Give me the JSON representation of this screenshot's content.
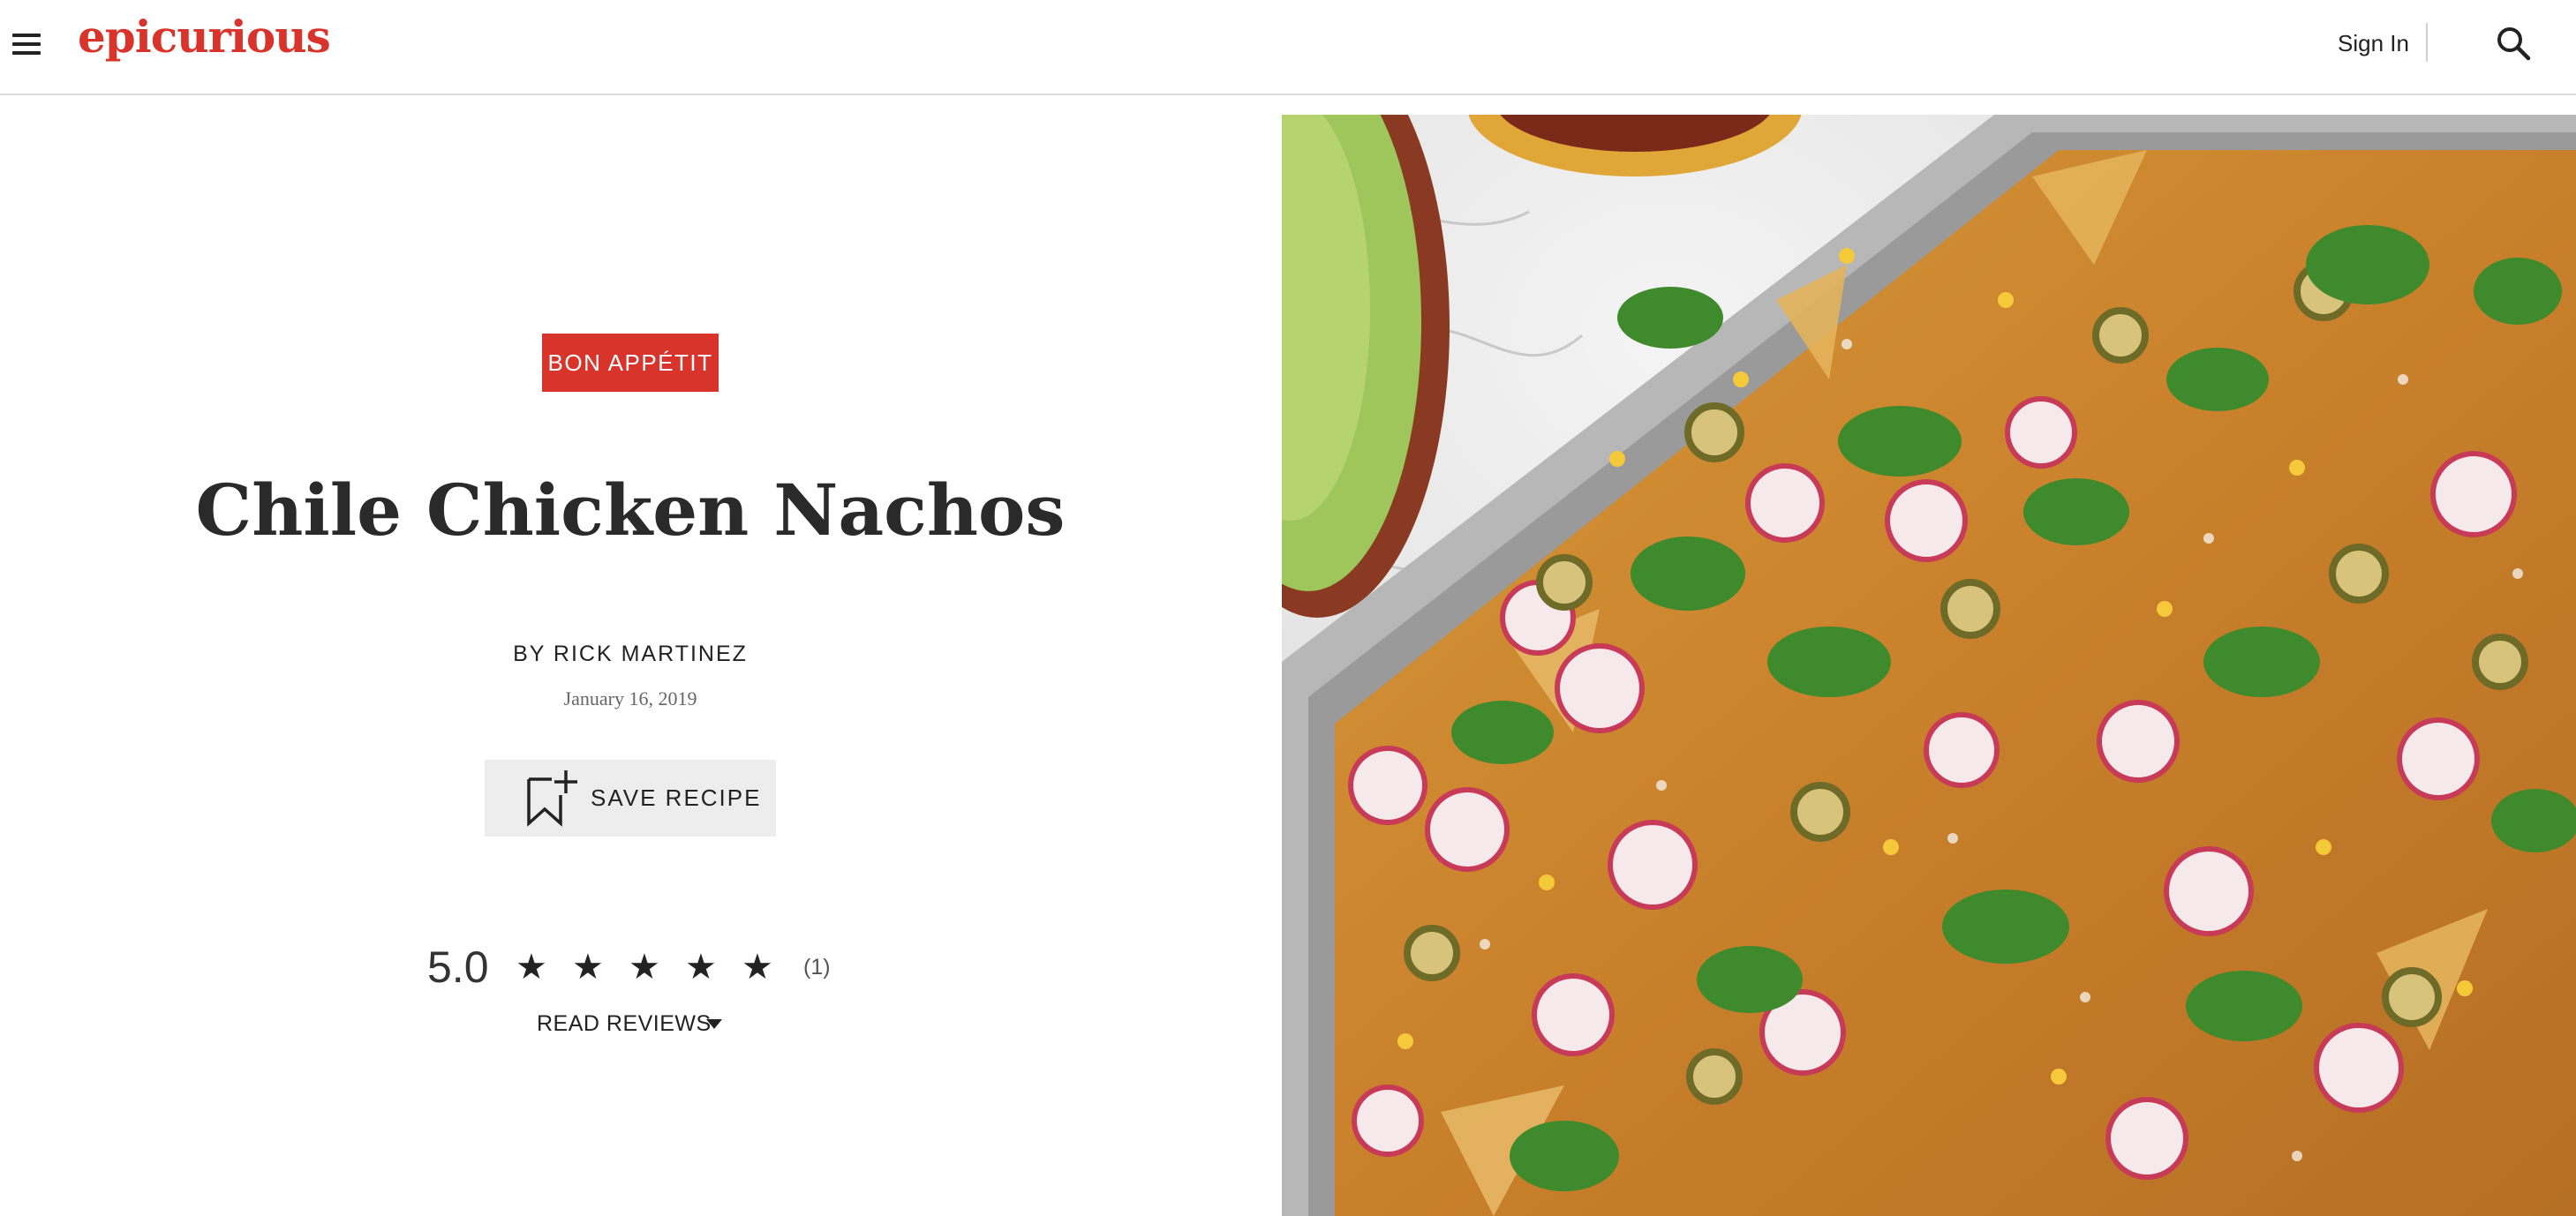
{
  "header": {
    "logo": "epicurious",
    "sign_in": "Sign In",
    "menu_icon": "hamburger-menu-icon",
    "search_icon": "search-icon",
    "brand_color": "#d9342b"
  },
  "recipe": {
    "badge": "BON APPÉTIT",
    "title": "Chile Chicken Nachos",
    "author": "BY RICK MARTINEZ",
    "date": "January 16, 2019",
    "save_label": "SAVE RECIPE",
    "save_icon": "bookmark-plus-icon"
  },
  "rating": {
    "score": "5.0",
    "stars": 5,
    "max_stars": 5,
    "count": "(1)",
    "read_reviews": "READ REVIEWS"
  },
  "hero_image": {
    "subject": "nachos-photo"
  }
}
